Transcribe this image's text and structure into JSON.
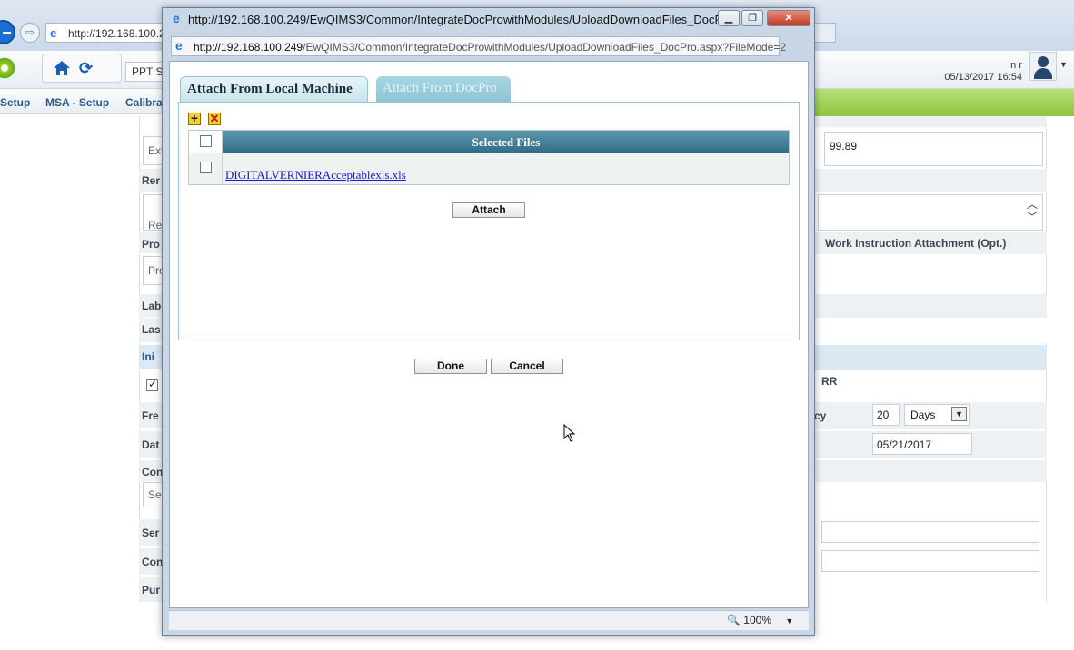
{
  "browser": {
    "address_partial": "http://192.168.100.2",
    "icon": "ie-icon"
  },
  "app": {
    "project_select": "PPT St",
    "user_name": "n r",
    "datetime": "05/13/2017 16:54",
    "menu": [
      "Setup",
      "MSA - Setup",
      "Calibrat"
    ]
  },
  "form_left": {
    "labels": [
      "Rer",
      "Pro",
      "Lab",
      "Las",
      "Ini",
      "Fre",
      "Dat",
      "Con",
      "Ser",
      "Con",
      "Pur"
    ],
    "inputs": [
      "Ext",
      "Ren",
      "Pro",
      "Se"
    ]
  },
  "form_right": {
    "accuracy_value": "99.89",
    "work_instruction_label": "Work Instruction Attachment (Opt.)",
    "rr_label": "RR",
    "frequency_suffix": "cy",
    "frequency_value": "20",
    "frequency_unit": "Days",
    "date_value": "05/21/2017"
  },
  "popup": {
    "title": "http://192.168.100.249/EwQIMS3/Common/IntegrateDocProwithModules/UploadDownloadFiles_DocPro.as...",
    "address_host": "http://192.168.100.249",
    "address_path": "/EwQIMS3/Common/IntegrateDocProwithModules/UploadDownloadFiles_DocPro.aspx?FileMode=2",
    "tabs": [
      "Attach From Local Machine",
      "Attach From DocPro"
    ],
    "grid_header": "Selected Files",
    "file_name": "DIGITALVERNIERAcceptablexls.xls",
    "attach_label": "Attach",
    "done_label": "Done",
    "cancel_label": "Cancel",
    "zoom": "100%",
    "minimize_glyph": "▁",
    "restore_glyph": "❐",
    "close_glyph": "✕",
    "add_glyph": "+",
    "delete_glyph": "✕"
  }
}
